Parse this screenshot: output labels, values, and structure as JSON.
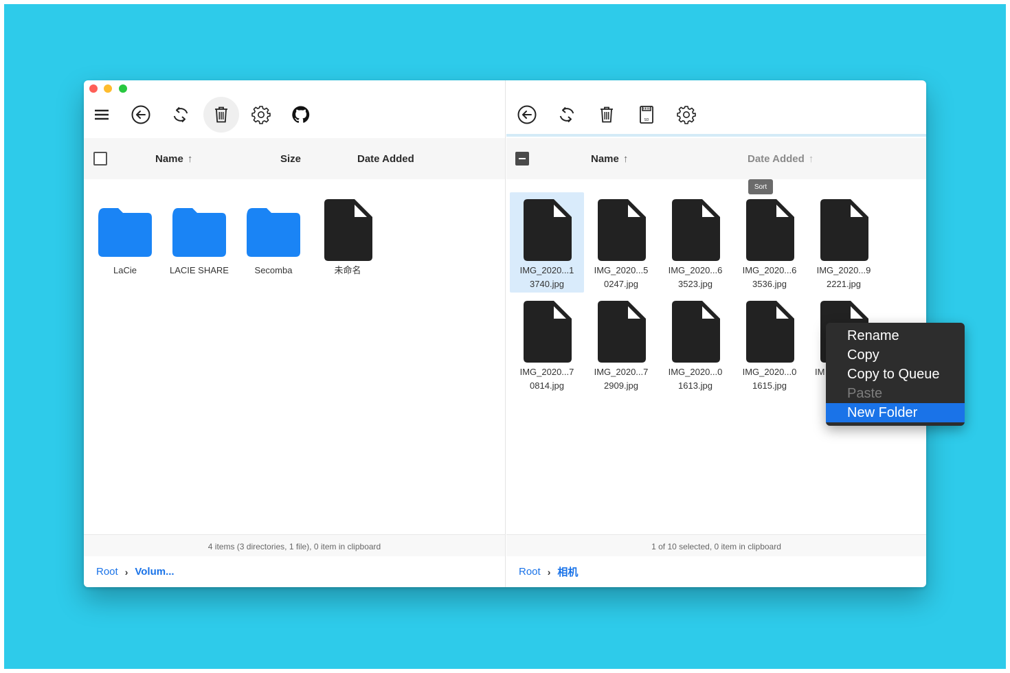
{
  "window": {
    "traffic_lights": {
      "close": "#fe5f57",
      "minimize": "#febc2e",
      "zoom": "#28c840"
    }
  },
  "colors": {
    "background": "#2ecbea",
    "folder": "#1a84f5",
    "file": "#222222",
    "accent": "#1a73e8",
    "selection": "#d9ebfb"
  },
  "left_pane": {
    "toolbar": [
      "menu-icon",
      "back-icon",
      "refresh-icon",
      "trash-icon",
      "settings-icon",
      "github-icon"
    ],
    "columns": {
      "name": "Name",
      "size": "Size",
      "date_added": "Date Added"
    },
    "items": [
      {
        "label": "LaCie",
        "icon": "folder-icon"
      },
      {
        "label": "LACIE SHARE",
        "icon": "folder-icon"
      },
      {
        "label": "Secomba",
        "icon": "folder-icon"
      },
      {
        "label": "未命名",
        "icon": "file-icon"
      }
    ],
    "status": "4 items (3 directories, 1 file), 0 item in clipboard",
    "breadcrumb": {
      "root": "Root",
      "current": "Volum..."
    }
  },
  "right_pane": {
    "toolbar": [
      "back-icon",
      "refresh-icon",
      "trash-icon",
      "sd-card-icon",
      "settings-icon"
    ],
    "columns": {
      "name": "Name",
      "date_added": "Date Added"
    },
    "tooltip": "Sort",
    "items": [
      {
        "line1": "IMG_2020...1",
        "line2": "3740.jpg",
        "selected": true
      },
      {
        "line1": "IMG_2020...5",
        "line2": "0247.jpg"
      },
      {
        "line1": "IMG_2020...6",
        "line2": "3523.jpg"
      },
      {
        "line1": "IMG_2020...6",
        "line2": "3536.jpg"
      },
      {
        "line1": "IMG_2020...9",
        "line2": "2221.jpg"
      },
      {
        "line1": "IMG_2020...7",
        "line2": "0814.jpg"
      },
      {
        "line1": "IMG_2020...7",
        "line2": "2909.jpg"
      },
      {
        "line1": "IMG_2020...0",
        "line2": "1613.jpg"
      },
      {
        "line1": "IMG_2020...0",
        "line2": "1615.jpg"
      },
      {
        "line1": "IM",
        "line2": ""
      }
    ],
    "status": "1 of 10 selected, 0 item in clipboard",
    "breadcrumb": {
      "root": "Root",
      "current": "相机"
    }
  },
  "context_menu": {
    "items": [
      {
        "label": "Rename",
        "state": "enabled"
      },
      {
        "label": "Copy",
        "state": "enabled"
      },
      {
        "label": "Copy to Queue",
        "state": "enabled"
      },
      {
        "label": "Paste",
        "state": "disabled"
      },
      {
        "label": "New Folder",
        "state": "highlighted"
      }
    ]
  }
}
